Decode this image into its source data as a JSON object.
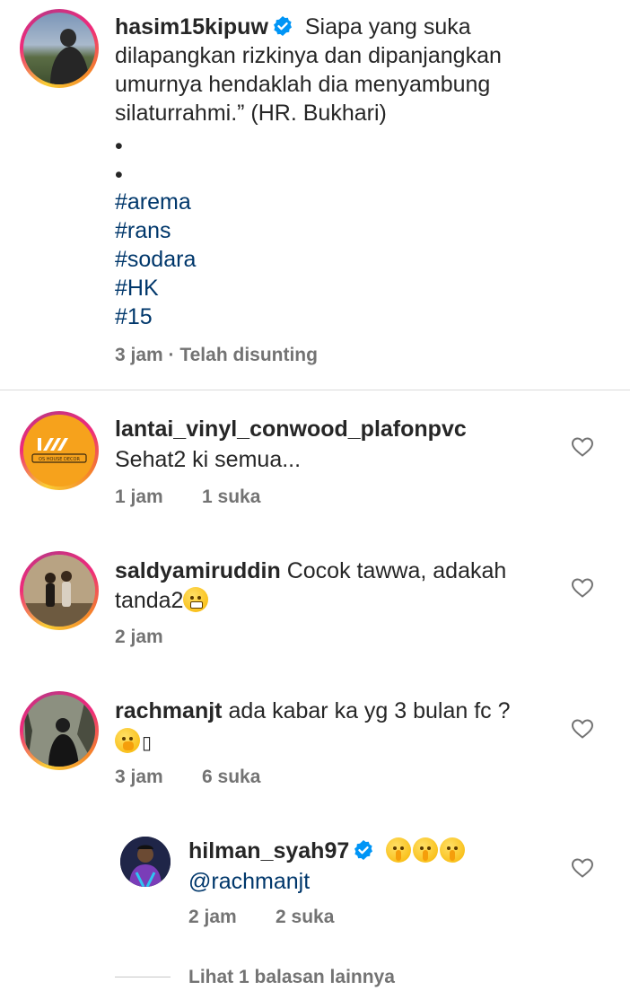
{
  "post": {
    "username": "hasim15kipuw",
    "caption_lines": [
      "Siapa yang suka",
      "dilapangkan rizkinya dan dipanjangkan",
      "umurnya hendaklah dia menyambung",
      "silaturrahmi.” (HR. Bukhari)"
    ],
    "bullets": [
      "•",
      "•"
    ],
    "hashtags": [
      "#arema",
      "#rans",
      "#sodara",
      "#HK",
      "#15"
    ],
    "meta": "3 jam · Telah disunting"
  },
  "comments": [
    {
      "username": "lantai_vinyl_conwood_plafonpvc",
      "text": "Sehat2 ki semua...",
      "time": "1 jam",
      "likes": "1 suka",
      "avatar_logo_text": "OS HOUSE DECOR"
    },
    {
      "username": "saldyamiruddin",
      "text_line1": "Cocok tawwa, adakah",
      "text_line2": "tanda2",
      "time": "2 jam"
    },
    {
      "username": "rachmanjt",
      "text": "ada kabar ka yg 3 bulan fc ?",
      "text_line2_tail": "▯",
      "time": "3 jam",
      "likes": "6 suka"
    }
  ],
  "reply": {
    "username": "hilman_syah97",
    "mention": "@rachmanjt",
    "time": "2 jam",
    "likes": "2 suka"
  },
  "more_replies": "Lihat 1 balasan lainnya",
  "colors": {
    "hashtag": "#00376b",
    "verified": "#0095f6",
    "meta": "#737373"
  }
}
